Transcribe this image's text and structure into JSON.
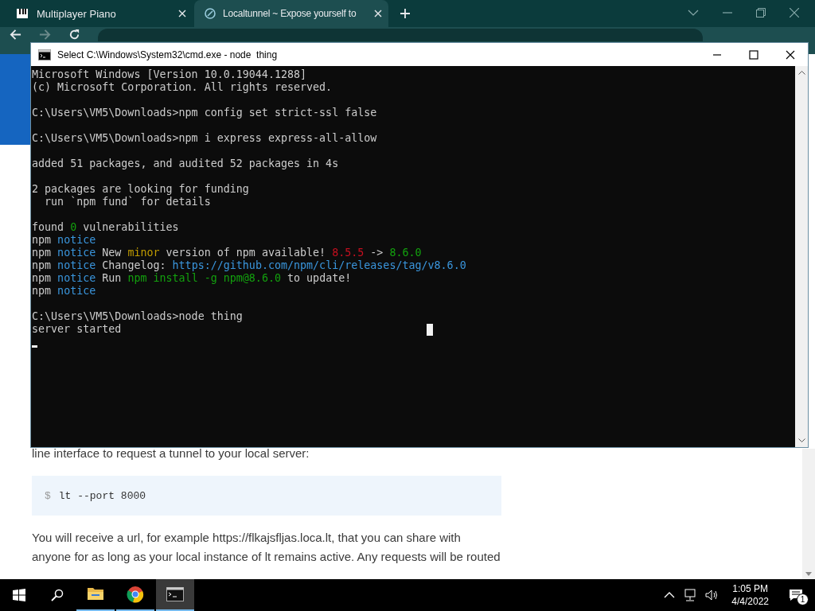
{
  "browser": {
    "tabs": [
      {
        "title": "Multiplayer Piano",
        "kind": "piano",
        "selected": false
      },
      {
        "title": "Localtunnel ~ Expose yourself to",
        "kind": "tunnel",
        "selected": true
      }
    ]
  },
  "page": {
    "intro": "line interface to request a tunnel to your local server:",
    "code": {
      "prompt": "$",
      "command": "lt --port 8000"
    },
    "paragraph": "You will receive a url, for example https://flkajsfljas.loca.lt, that you can share with anyone for as long as your local instance of lt remains active. Any requests will be routed"
  },
  "terminal": {
    "title": "Select C:\\Windows\\System32\\cmd.exe - node  thing",
    "lines": [
      {
        "kind": "text",
        "segments": [
          {
            "text": "Microsoft Windows [Version 10.0.19044.1288]",
            "color": "#cccccc"
          }
        ]
      },
      {
        "kind": "text",
        "segments": [
          {
            "text": "(c) Microsoft Corporation. All rights reserved.",
            "color": "#cccccc"
          }
        ]
      },
      {
        "kind": "blank"
      },
      {
        "kind": "text",
        "segments": [
          {
            "text": "C:\\Users\\VM5\\Downloads>npm config set strict-ssl false",
            "color": "#cccccc"
          }
        ]
      },
      {
        "kind": "blank"
      },
      {
        "kind": "text",
        "segments": [
          {
            "text": "C:\\Users\\VM5\\Downloads>npm i express express-all-allow",
            "color": "#cccccc"
          }
        ]
      },
      {
        "kind": "blank"
      },
      {
        "kind": "text",
        "segments": [
          {
            "text": "added 51 packages, and audited 52 packages in 4s",
            "color": "#cccccc"
          }
        ]
      },
      {
        "kind": "blank"
      },
      {
        "kind": "text",
        "segments": [
          {
            "text": "2 packages are looking for funding",
            "color": "#cccccc"
          }
        ]
      },
      {
        "kind": "text",
        "segments": [
          {
            "text": "  run `npm fund` for details",
            "color": "#cccccc"
          }
        ]
      },
      {
        "kind": "blank"
      },
      {
        "kind": "text",
        "segments": [
          {
            "text": "found ",
            "color": "#cccccc"
          },
          {
            "text": "0",
            "color": "#13a10e"
          },
          {
            "text": " vulnerabilities",
            "color": "#cccccc"
          }
        ]
      },
      {
        "kind": "text",
        "segments": [
          {
            "text": "npm ",
            "color": "#cccccc"
          },
          {
            "text": "notice",
            "color": "#3a96dd"
          }
        ]
      },
      {
        "kind": "text",
        "segments": [
          {
            "text": "npm ",
            "color": "#cccccc"
          },
          {
            "text": "notice",
            "color": "#3a96dd"
          },
          {
            "text": " New ",
            "color": "#cccccc"
          },
          {
            "text": "minor",
            "color": "#c19c00"
          },
          {
            "text": " version of npm available! ",
            "color": "#cccccc"
          },
          {
            "text": "8.5.5",
            "color": "#c50f1f"
          },
          {
            "text": " -> ",
            "color": "#cccccc"
          },
          {
            "text": "8.6.0",
            "color": "#13a10e"
          }
        ]
      },
      {
        "kind": "text",
        "segments": [
          {
            "text": "npm ",
            "color": "#cccccc"
          },
          {
            "text": "notice",
            "color": "#3a96dd"
          },
          {
            "text": " Changelog: ",
            "color": "#cccccc"
          },
          {
            "text": "https://github.com/npm/cli/releases/tag/v8.6.0",
            "color": "#3a96dd"
          }
        ]
      },
      {
        "kind": "text",
        "segments": [
          {
            "text": "npm ",
            "color": "#cccccc"
          },
          {
            "text": "notice",
            "color": "#3a96dd"
          },
          {
            "text": " Run ",
            "color": "#cccccc"
          },
          {
            "text": "npm install -g npm@8.6.0",
            "color": "#13a10e"
          },
          {
            "text": " to update!",
            "color": "#cccccc"
          }
        ]
      },
      {
        "kind": "text",
        "segments": [
          {
            "text": "npm ",
            "color": "#cccccc"
          },
          {
            "text": "notice",
            "color": "#3a96dd"
          }
        ]
      },
      {
        "kind": "blank"
      },
      {
        "kind": "text",
        "segments": [
          {
            "text": "C:\\Users\\VM5\\Downloads>node thing",
            "color": "#cccccc"
          }
        ]
      },
      {
        "kind": "text",
        "segments": [
          {
            "text": "server started",
            "color": "#cccccc"
          }
        ],
        "block_cursor": true
      },
      {
        "kind": "cursor"
      }
    ]
  },
  "taskbar": {
    "apps": [
      {
        "kind": "folder",
        "selected": false
      },
      {
        "kind": "browser",
        "selected": false
      },
      {
        "kind": "terminal",
        "selected": true
      }
    ],
    "time": "1:05 PM",
    "date": "4/4/2022",
    "notification_count": "1"
  }
}
